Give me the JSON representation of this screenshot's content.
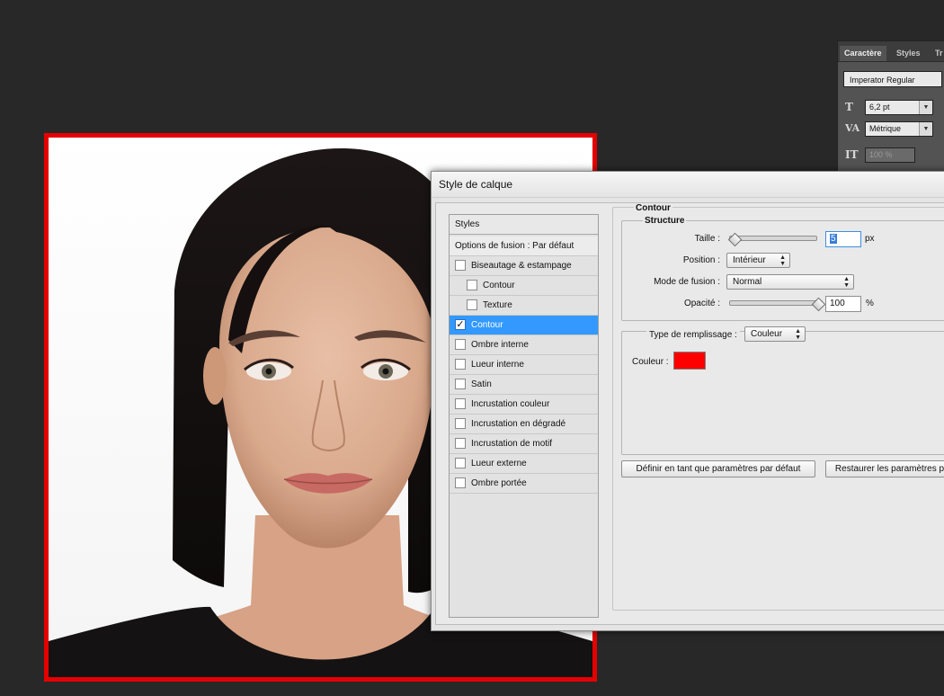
{
  "character_panel": {
    "tabs": [
      "Caractère",
      "Styles",
      "Tr"
    ],
    "font_family": "Imperator Regular",
    "font_size": "6,2 pt",
    "kerning": "Métrique",
    "vertical_scale": "100 %"
  },
  "photo": {
    "stroke_color": "#e60000"
  },
  "dialog": {
    "title": "Style de calque",
    "styles_header": "Styles",
    "blend_options": "Options de fusion : Par défaut",
    "style_items": [
      {
        "label": "Biseautage & estampage",
        "checked": false
      },
      {
        "label": "Contour",
        "checked": false
      },
      {
        "label": "Texture",
        "checked": false
      },
      {
        "label": "Contour",
        "checked": true
      },
      {
        "label": "Ombre interne",
        "checked": false
      },
      {
        "label": "Lueur interne",
        "checked": false
      },
      {
        "label": "Satin",
        "checked": false
      },
      {
        "label": "Incrustation couleur",
        "checked": false
      },
      {
        "label": "Incrustation en dégradé",
        "checked": false
      },
      {
        "label": "Incrustation de motif",
        "checked": false
      },
      {
        "label": "Lueur externe",
        "checked": false
      },
      {
        "label": "Ombre portée",
        "checked": false
      }
    ],
    "section_title": "Contour",
    "structure_title": "Structure",
    "size_label": "Taille :",
    "size_value": "5",
    "size_unit": "px",
    "position_label": "Position :",
    "position_value": "Intérieur",
    "blend_mode_label": "Mode de fusion :",
    "blend_mode_value": "Normal",
    "opacity_label": "Opacité :",
    "opacity_value": "100",
    "opacity_unit": "%",
    "fill_type_label": "Type de remplissage :",
    "fill_type_value": "Couleur",
    "color_label": "Couleur :",
    "stroke_color": "#ff0000",
    "set_default_button": "Définir en tant que paramètres par défaut",
    "restore_default_button": "Restaurer les paramètres p"
  }
}
